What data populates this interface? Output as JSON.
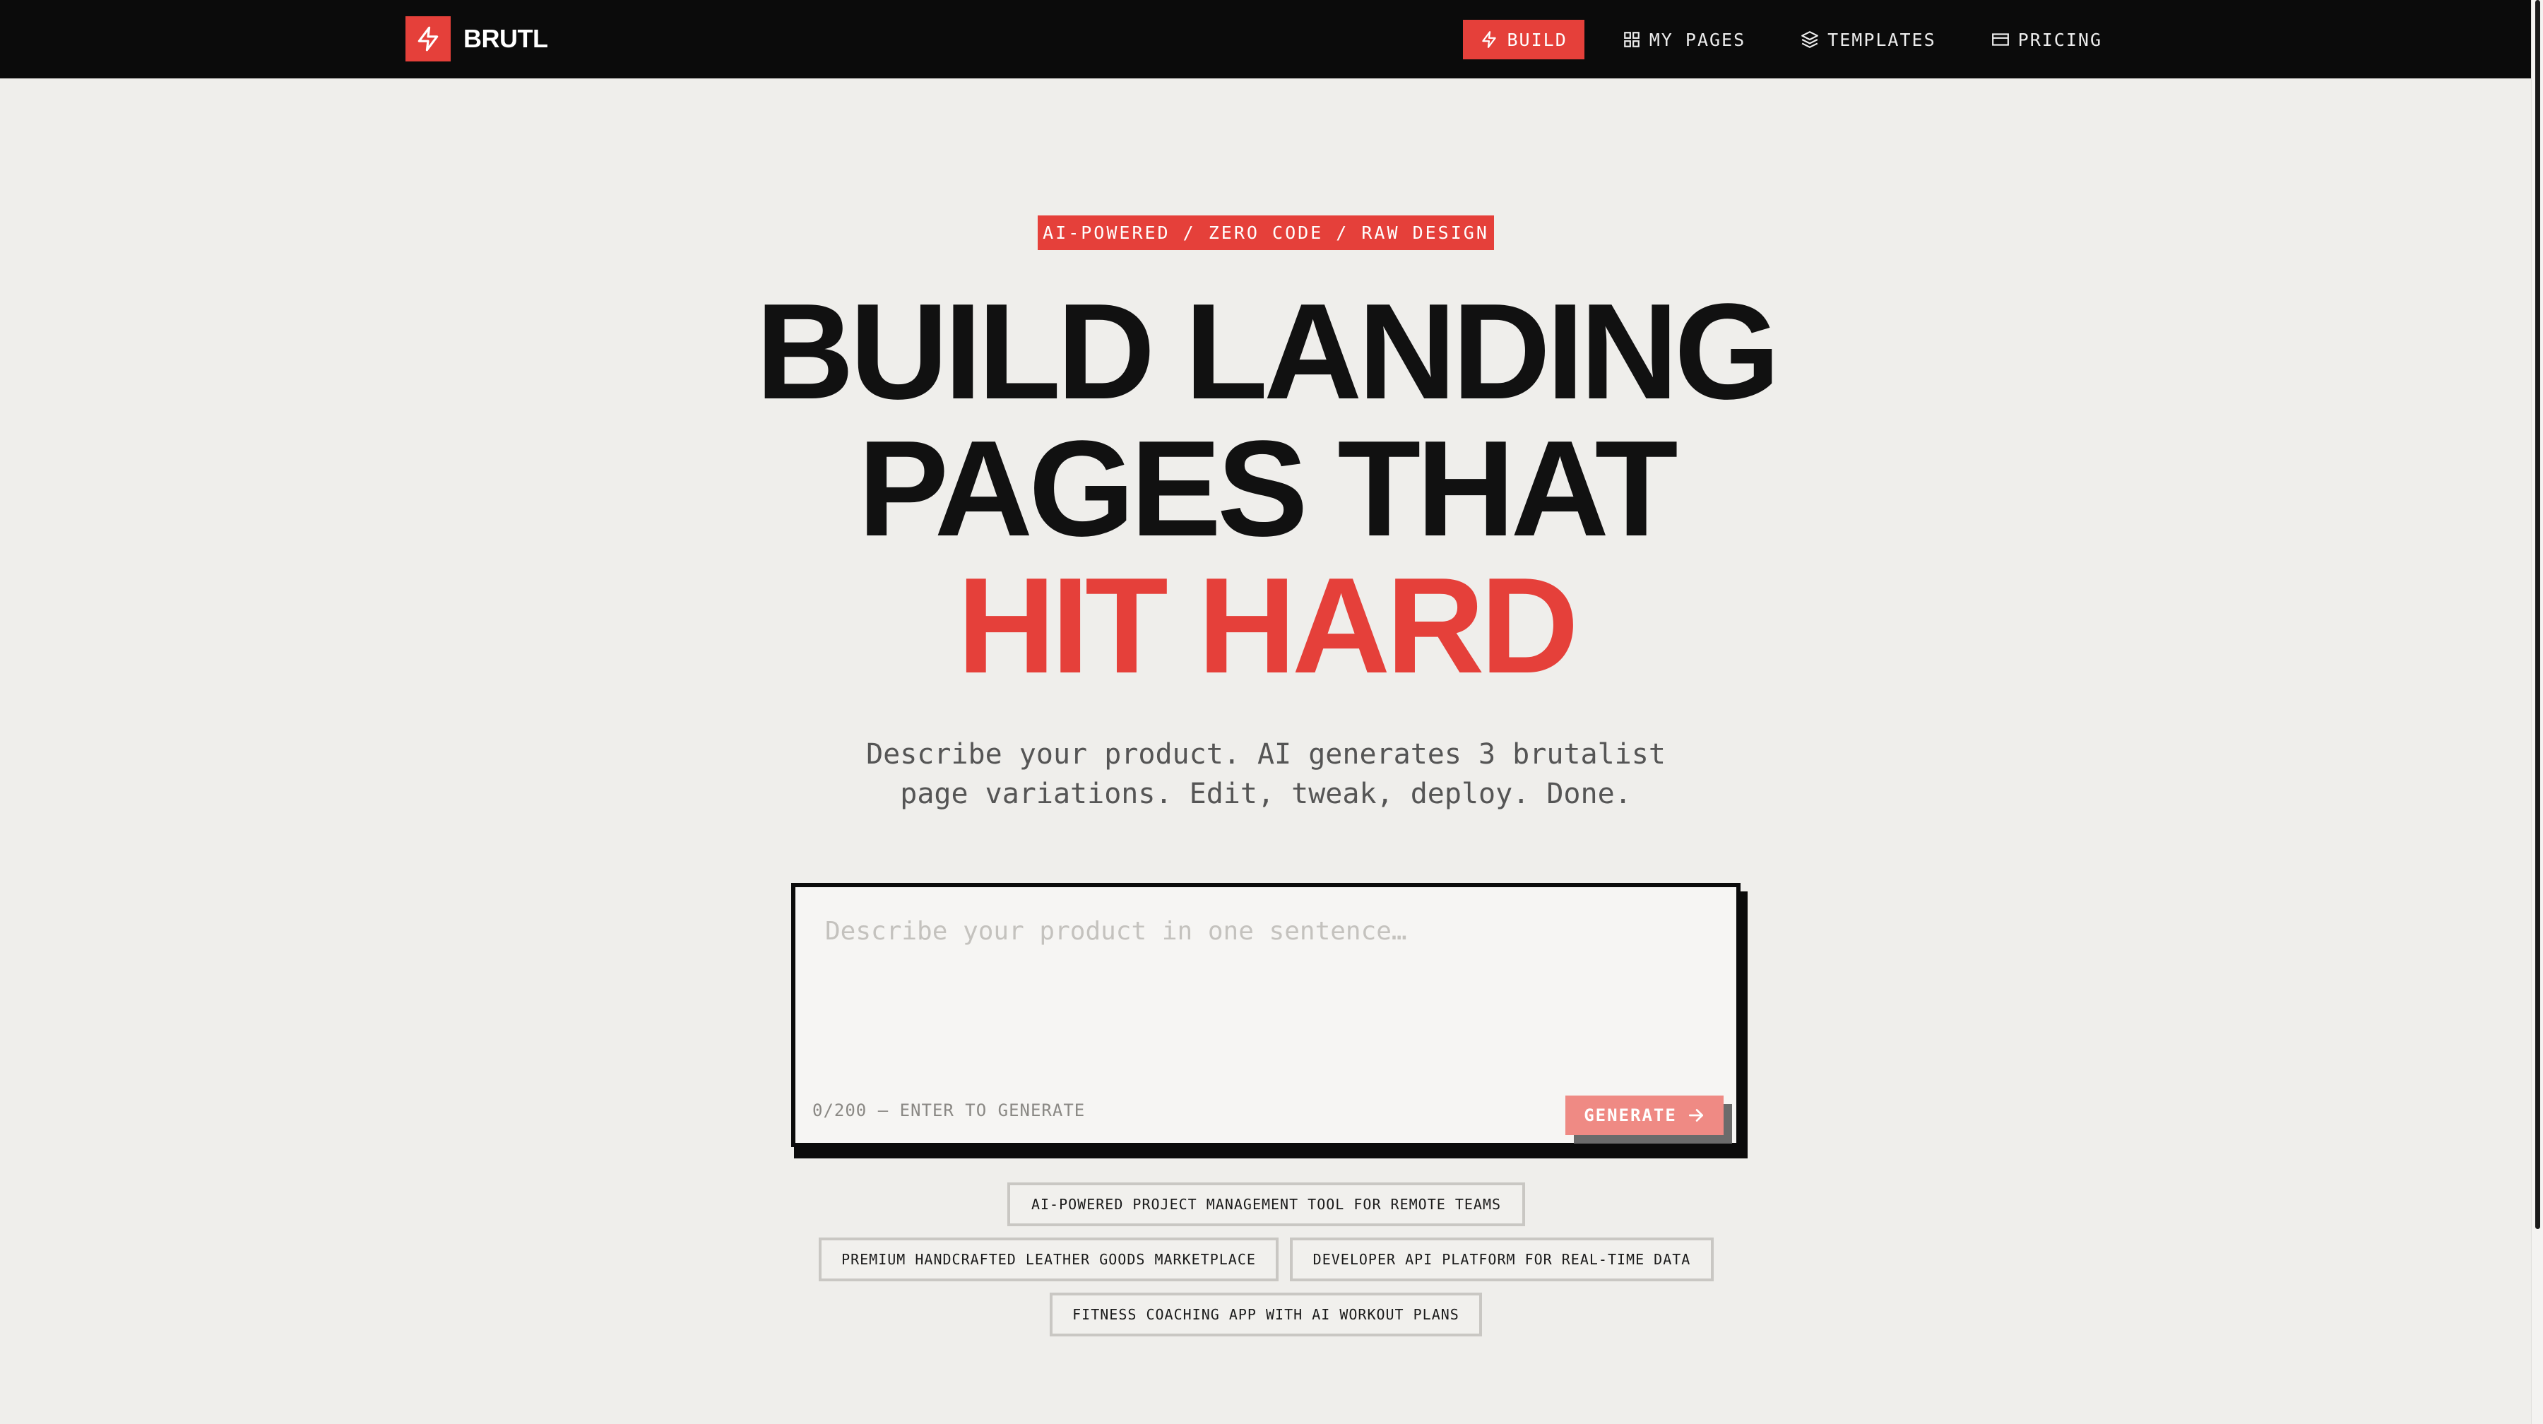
{
  "brand": {
    "name": "BRUTL",
    "icon": "lightning-bolt-icon",
    "accent_color": "#e5403a"
  },
  "nav": {
    "items": [
      {
        "label": "BUILD",
        "icon": "zap-icon",
        "active": true
      },
      {
        "label": "MY PAGES",
        "icon": "grid-icon",
        "active": false
      },
      {
        "label": "TEMPLATES",
        "icon": "layers-icon",
        "active": false
      },
      {
        "label": "PRICING",
        "icon": "credit-card-icon",
        "active": false
      }
    ]
  },
  "hero": {
    "badge": "AI-POWERED / ZERO CODE / RAW DESIGN",
    "headline_line1": "BUILD LANDING",
    "headline_line2": "PAGES THAT",
    "headline_accent": "HIT HARD",
    "subtext_line1": "Describe your product. AI generates 3 brutalist",
    "subtext_line2": "page variations. Edit, tweak, deploy. Done."
  },
  "prompt": {
    "placeholder": "Describe your product in one sentence…",
    "value": "",
    "counter": "0/200 — ENTER TO GENERATE",
    "generate_label": "GENERATE",
    "generate_icon": "arrow-right-icon"
  },
  "suggestions": [
    "AI-POWERED PROJECT MANAGEMENT TOOL FOR REMOTE TEAMS",
    "PREMIUM HANDCRAFTED LEATHER GOODS MARKETPLACE",
    "DEVELOPER API PLATFORM FOR REAL-TIME DATA",
    "FITNESS COACHING APP WITH AI WORKOUT PLANS"
  ]
}
